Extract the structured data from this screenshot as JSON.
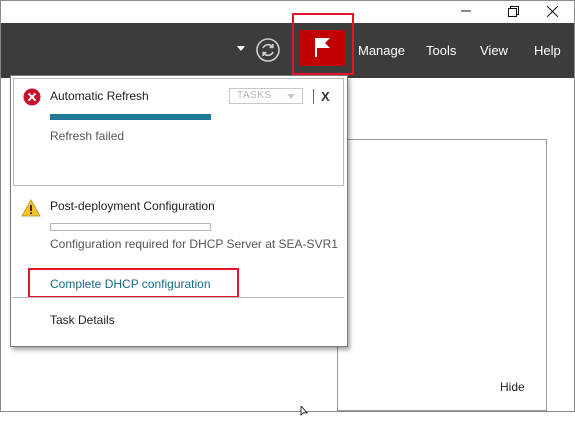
{
  "window_controls": {
    "minimize_icon": "minimize-icon",
    "restore_icon": "restore-icon",
    "close_icon": "close-icon"
  },
  "menu": {
    "items": [
      {
        "label": "Manage"
      },
      {
        "label": "Tools"
      },
      {
        "label": "View"
      },
      {
        "label": "Help"
      }
    ]
  },
  "toolbar": {
    "refresh_icon": "refresh-icon",
    "notifications_icon": "flag-icon"
  },
  "notifications": {
    "items": [
      {
        "title": "Automatic Refresh",
        "status": "Refresh failed",
        "icon": "error-icon",
        "progress": 1.0,
        "tasks_label": "TASKS",
        "dismiss_label": "X"
      },
      {
        "title": "Post-deployment Configuration",
        "status": "Configuration required for DHCP Server at SEA-SVR1",
        "icon": "warning-icon",
        "progress": 0.0,
        "action_link": "Complete DHCP configuration"
      }
    ],
    "task_details_label": "Task Details"
  },
  "page": {
    "hide_label": "Hide"
  },
  "colors": {
    "command_bar": "#3c3c3c",
    "flag_button": "#c00000",
    "highlight": "#e8132a",
    "progress": "#1f7a98",
    "link": "#1a6985"
  }
}
